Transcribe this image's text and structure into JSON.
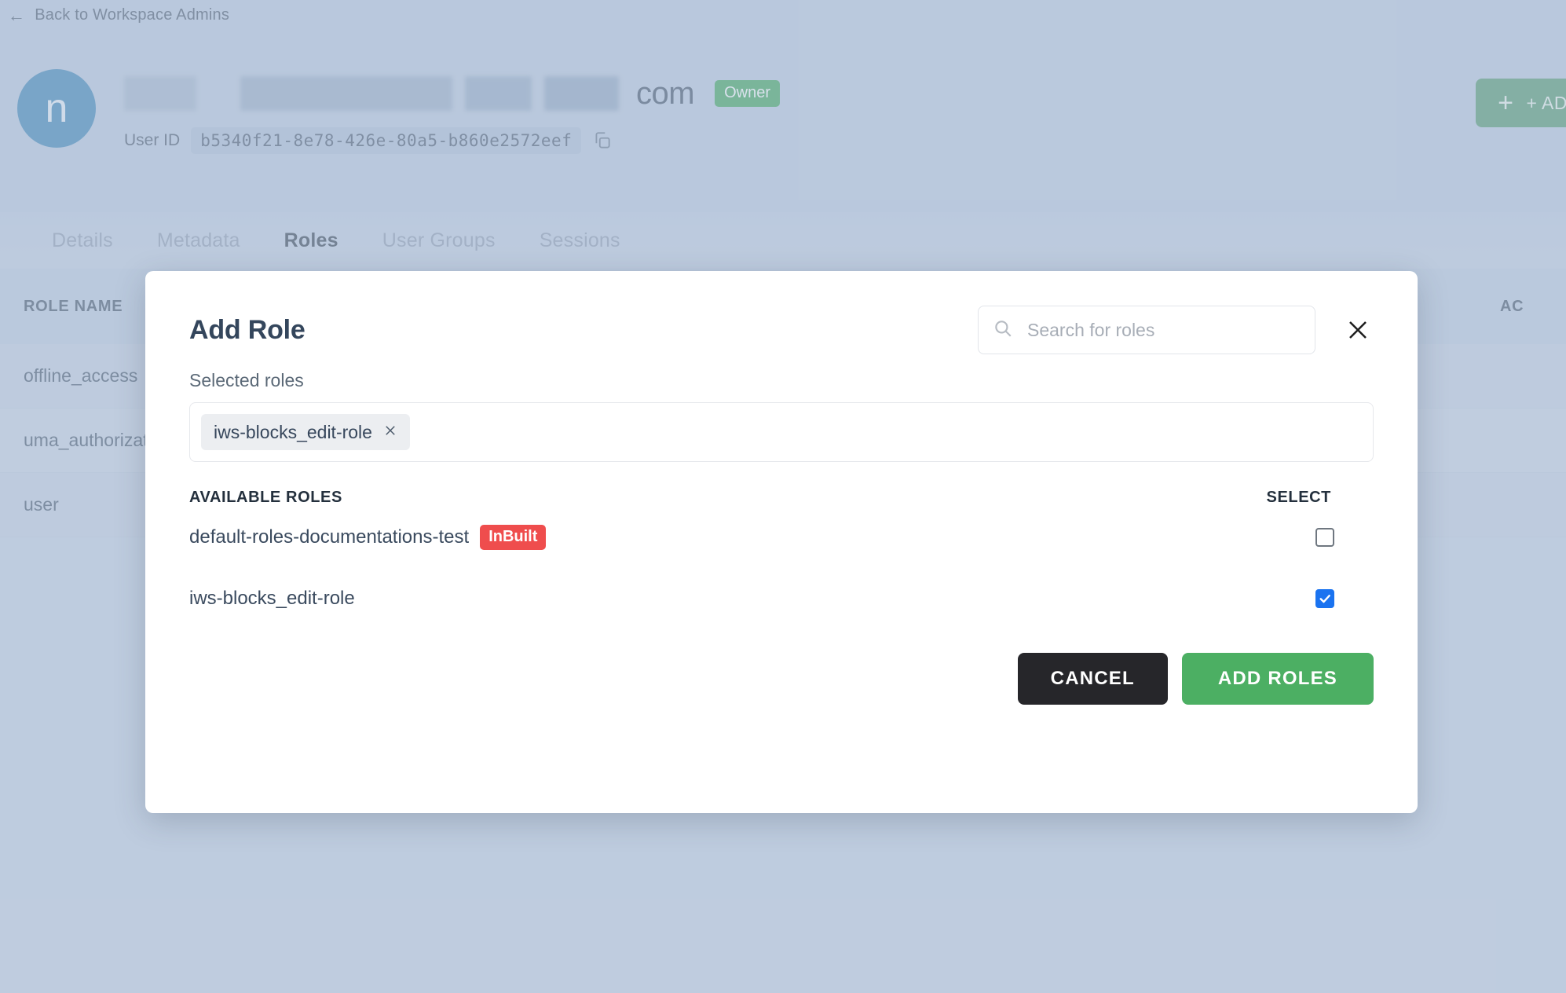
{
  "backdrop": {
    "back_link": "Back to Workspace Admins",
    "back_arrow_icon": "arrow-left-icon",
    "avatar_initial": "n",
    "name_suffix": "com",
    "owner_badge": "Owner",
    "user_id_label": "User ID",
    "user_id_value": "b5340f21-8e78-426e-80a5-b860e2572eef",
    "copy_icon": "copy-icon",
    "add_button_label": "+ AD",
    "plus_icon": "plus-icon",
    "tabs": [
      {
        "label": "Details",
        "active": false
      },
      {
        "label": "Metadata",
        "active": false
      },
      {
        "label": "Roles",
        "active": true
      },
      {
        "label": "User Groups",
        "active": false
      },
      {
        "label": "Sessions",
        "active": false
      }
    ],
    "table": {
      "columns": [
        "ROLE NAME",
        "AC"
      ],
      "rows": [
        {
          "role_name": "offline_access"
        },
        {
          "role_name": "uma_authorization"
        },
        {
          "role_name": "user"
        }
      ]
    }
  },
  "modal": {
    "title": "Add Role",
    "search": {
      "placeholder": "Search for roles",
      "value": "",
      "icon": "search-icon"
    },
    "close_icon": "close-icon",
    "selected_label": "Selected roles",
    "selected_chips": [
      {
        "label": "iws-blocks_edit-role",
        "remove_icon": "close-icon"
      }
    ],
    "list_headers": {
      "name": "AVAILABLE ROLES",
      "select": "SELECT"
    },
    "available_roles": [
      {
        "name": "default-roles-documentations-test",
        "badge": "InBuilt",
        "badge_color": "#ef4d4d",
        "checked": false
      },
      {
        "name": "iws-blocks_edit-role",
        "badge": "",
        "checked": true
      }
    ],
    "buttons": {
      "cancel": "CANCEL",
      "add": "ADD ROLES"
    },
    "colors": {
      "checkbox_checked": "#1a73f0",
      "primary_green": "#4caf63",
      "cancel_dark": "#26262a"
    }
  }
}
